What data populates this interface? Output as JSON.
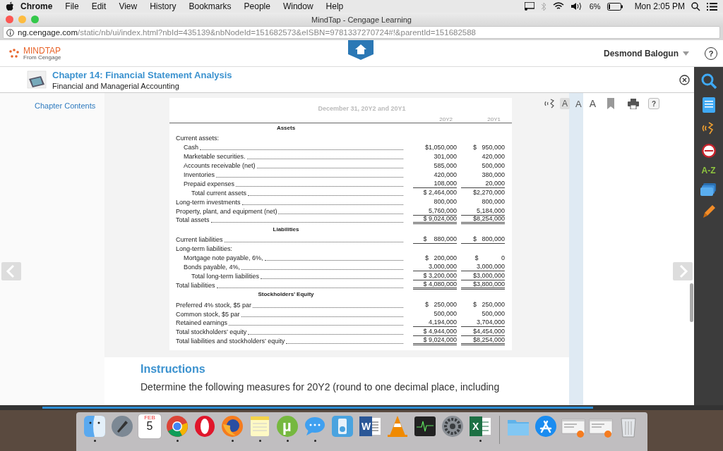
{
  "menubar": {
    "app": "Chrome",
    "menus": [
      "File",
      "Edit",
      "View",
      "History",
      "Bookmarks",
      "People",
      "Window",
      "Help"
    ],
    "battery": "6%",
    "clock": "Mon 2:05 PM"
  },
  "window": {
    "title": "MindTap - Cengage Learning"
  },
  "address_bar": {
    "host": "ng.cengage.com",
    "path": "/static/nb/ui/index.html?nbId=435139&nbNodeId=151682573&eISBN=9781337270724#!&parentId=151682588"
  },
  "header": {
    "logo": "MINDTAP",
    "tagline": "From Cengage",
    "user": "Desmond Balogun",
    "help": "?"
  },
  "chapter": {
    "title": "Chapter 14: Financial Statement Analysis",
    "subtitle": "Financial and Managerial Accounting"
  },
  "chapter_contents": "Chapter Contents",
  "toolbar": {
    "font_sizes": [
      {
        "label": "A",
        "selected": true
      },
      {
        "label": "A",
        "selected": false
      },
      {
        "label": "A",
        "selected": false
      }
    ],
    "help": "?"
  },
  "statement": {
    "date": "December 31, 20Y2 and 20Y1",
    "columns": [
      "20Y2",
      "20Y1"
    ],
    "sections": [
      {
        "heading": "Assets",
        "rows": [
          {
            "label": "Current assets:",
            "children": [
              {
                "label": "Cash",
                "values": [
                  "$1,050,000",
                  "$   950,000"
                ]
              },
              {
                "label": "Marketable securities.",
                "values": [
                  "301,000",
                  "420,000"
                ]
              },
              {
                "label": "Accounts receivable (net)",
                "values": [
                  "585,000",
                  "500,000"
                ]
              },
              {
                "label": "Inventories",
                "values": [
                  "420,000",
                  "380,000"
                ]
              },
              {
                "label": "Prepaid expenses",
                "values": [
                  "108,000",
                  "20,000"
                ],
                "kind": "underlined"
              }
            ],
            "total": {
              "label": "Total current assets",
              "values": [
                "$ 2,464,000",
                "$2,270,000"
              ]
            }
          },
          {
            "label": "Long-term investments",
            "values": [
              "800,000",
              "800,000"
            ]
          },
          {
            "label": "Property, plant, and equipment (net)",
            "values": [
              "5,760,000",
              "5,184,000"
            ],
            "kind": "underlined"
          },
          {
            "label": "Total assets",
            "values": [
              "$ 9,024,000",
              "$8,254,000"
            ],
            "kind": "double-underlined"
          }
        ]
      },
      {
        "heading": "Liabilities",
        "rows": [
          {
            "label": "Current liabilities",
            "values": [
              "$    880,000",
              "$   800,000"
            ],
            "kind": "underlined"
          },
          {
            "label": "Long-term liabilities:",
            "children": [
              {
                "label": "Mortgage note payable, 6%,",
                "values": [
                  "$   200,000",
                  "$             0"
                ]
              },
              {
                "label": "Bonds payable, 4%,",
                "values": [
                  "3,000,000",
                  "3,000,000"
                ],
                "kind": "underlined"
              }
            ],
            "total": {
              "label": "Total long-term liabilities",
              "values": [
                "$ 3,200,000",
                "$3,000,000"
              ],
              "kind": "underlined"
            }
          },
          {
            "label": "Total liabilities",
            "values": [
              "$ 4,080,000",
              "$3,800,000"
            ],
            "kind": "double-underlined"
          }
        ]
      },
      {
        "heading": "Stockholders’ Equity",
        "rows": [
          {
            "label": "Preferred 4% stock, $5 par",
            "values": [
              "$   250,000",
              "$   250,000"
            ]
          },
          {
            "label": "Common stock, $5 par",
            "values": [
              "500,000",
              "500,000"
            ]
          },
          {
            "label": "Retained earnings",
            "values": [
              "4,194,000",
              "3,704,000"
            ],
            "kind": "underlined"
          },
          {
            "label": "Total stockholders’ equity",
            "values": [
              "$ 4,944,000",
              "$4,454,000"
            ],
            "kind": "underlined"
          },
          {
            "label": "Total liabilities and stockholders’ equity",
            "values": [
              "$ 9,024,000",
              "$8,254,000"
            ],
            "kind": "double-underlined"
          }
        ]
      }
    ]
  },
  "instructions": {
    "heading": "Instructions",
    "text": "Determine the following measures for 20Y2 (round to one decimal place, including"
  },
  "tools": [
    {
      "kind": "search"
    },
    {
      "kind": "notebook"
    },
    {
      "kind": "readspeaker"
    },
    {
      "kind": "dictionary"
    },
    {
      "kind": "glossary",
      "label": "A-Z"
    },
    {
      "kind": "flashcards"
    },
    {
      "kind": "highlighter"
    }
  ],
  "dock": [
    {
      "kind": "finder",
      "running": true
    },
    {
      "kind": "launchpad",
      "running": false
    },
    {
      "kind": "calendar",
      "month": "FEB",
      "day": "5",
      "running": false
    },
    {
      "kind": "chrome",
      "running": true
    },
    {
      "kind": "opera",
      "running": false
    },
    {
      "kind": "firefox",
      "running": true
    },
    {
      "kind": "notes",
      "running": true
    },
    {
      "kind": "torrent",
      "glyph": "µ",
      "running": true
    },
    {
      "kind": "messages",
      "running": true
    },
    {
      "kind": "player",
      "running": false
    },
    {
      "kind": "word",
      "glyph": "W",
      "running": false
    },
    {
      "kind": "cone",
      "running": false
    },
    {
      "kind": "monitor",
      "running": false
    },
    {
      "kind": "gear",
      "running": false
    },
    {
      "kind": "excel",
      "glyph": "X",
      "running": true
    },
    {
      "kind": "separator"
    },
    {
      "kind": "folder",
      "running": false
    },
    {
      "kind": "appstore",
      "running": false
    },
    {
      "kind": "window",
      "running": false
    },
    {
      "kind": "window",
      "running": false
    },
    {
      "kind": "trash",
      "running": false
    }
  ]
}
